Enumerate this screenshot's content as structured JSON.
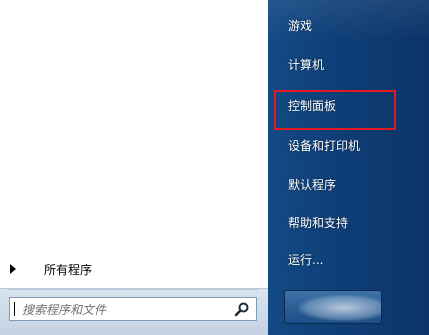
{
  "left_pane": {
    "all_programs_label": "所有程序",
    "search": {
      "placeholder": "搜索程序和文件"
    }
  },
  "right_pane": {
    "items": [
      {
        "label": "游戏"
      },
      {
        "label": "计算机"
      },
      {
        "label": "控制面板"
      },
      {
        "label": "设备和打印机"
      },
      {
        "label": "默认程序"
      },
      {
        "label": "帮助和支持"
      },
      {
        "label": "运行..."
      }
    ],
    "highlighted_item": "控制面板"
  },
  "colors": {
    "right_pane_bg": "#134a85",
    "highlight_border": "#e21b23",
    "left_pane_bg": "#ffffff",
    "search_border": "#7f9db9"
  },
  "icons": {
    "all_programs": "triangle-right-icon",
    "search": "magnifier-icon"
  }
}
